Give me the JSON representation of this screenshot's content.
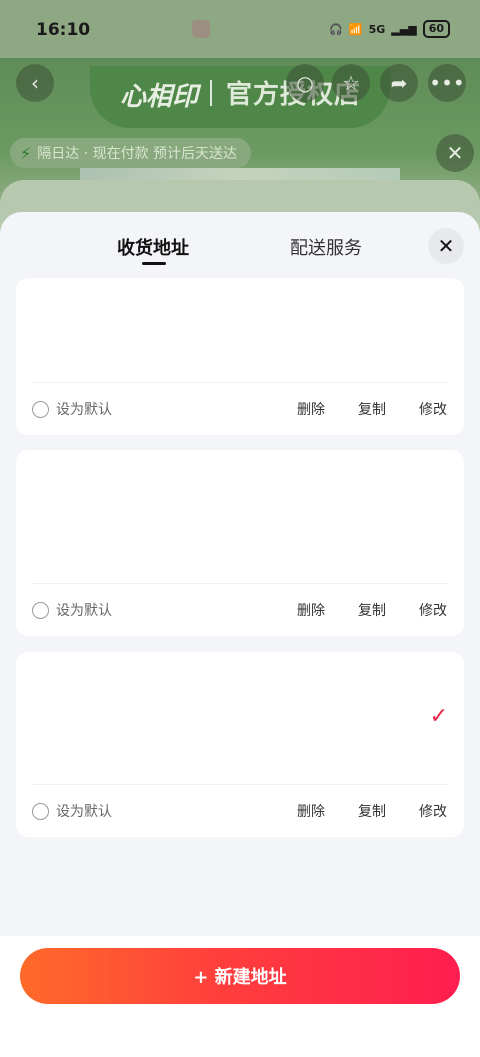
{
  "status_bar": {
    "time": "16:10",
    "network": "5G",
    "battery": "60"
  },
  "background": {
    "brand": "心相印",
    "store_title": "官方授权店",
    "delivery_badge": "隔日达 · 现在付款 预计后天送达"
  },
  "sheet": {
    "tabs": [
      {
        "label": "收货地址",
        "active": true
      },
      {
        "label": "配送服务",
        "active": false
      }
    ],
    "close_label": "✕",
    "addresses": [
      {
        "default_label": "设为默认",
        "delete": "删除",
        "copy": "复制",
        "edit": "修改",
        "selected": false
      },
      {
        "default_label": "设为默认",
        "delete": "删除",
        "copy": "复制",
        "edit": "修改",
        "selected": false
      },
      {
        "default_label": "设为默认",
        "delete": "删除",
        "copy": "复制",
        "edit": "修改",
        "selected": true
      }
    ],
    "new_address_button": "+ 新建地址"
  },
  "colors": {
    "accent": "#e8244b",
    "button_start": "#ff6a2a",
    "button_end": "#ff1d50"
  }
}
